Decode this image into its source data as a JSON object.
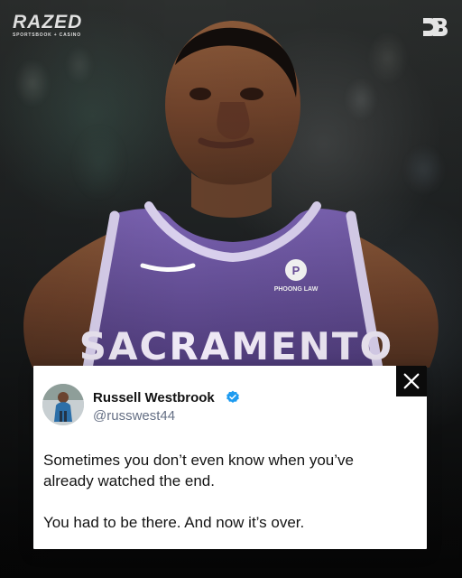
{
  "branding": {
    "top_left_title": "RAZED",
    "top_left_subtitle": "SPORTSBOOK + CASINO",
    "top_right_logo": "CB-logo"
  },
  "jersey": {
    "team_text": "SACRAMENTO",
    "sponsor_text": "PHOONG LAW"
  },
  "post": {
    "name": "Russell Westbrook",
    "handle": "@russwest44",
    "body": "Sometimes you don’t even know when you’ve\nalready watched the end.\n\nYou had to be there. And now it’s over.",
    "x_icon": "x-logo-icon",
    "verified_icon": "verified-badge-icon"
  },
  "colors": {
    "jersey_purple": "#6b4f9a",
    "jersey_trim": "#d8d1ea",
    "card_bg": "#ffffff",
    "x_badge_bg": "#0b0b0b",
    "verified_blue": "#1d9bf0"
  }
}
